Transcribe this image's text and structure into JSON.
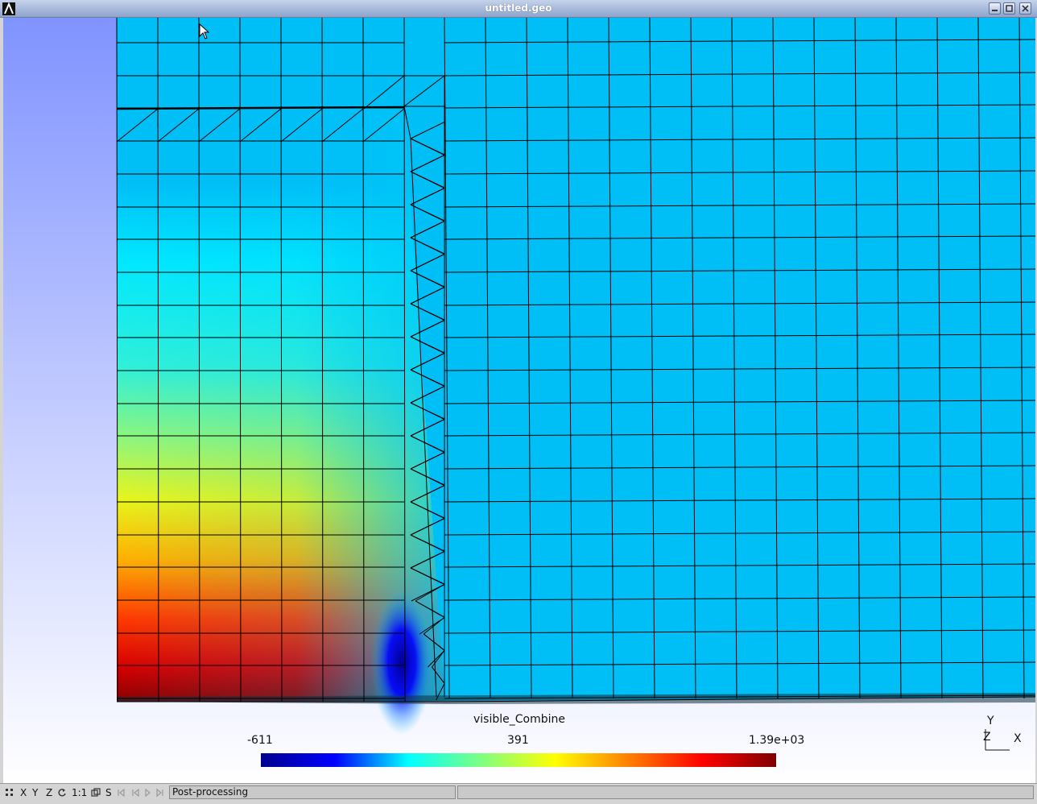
{
  "window": {
    "title": "untitled.geo"
  },
  "view": {
    "label": "visible_Combine",
    "scale": {
      "min": "-611",
      "mid": "391",
      "max": "1.39e+03"
    },
    "colormap": [
      "#00008f",
      "#0000ff",
      "#00ffff",
      "#7fff7f",
      "#ffff00",
      "#ff7f00",
      "#ff0000",
      "#7f0000"
    ],
    "mesh_color": "#000000",
    "outer_field_color": "#00bff7"
  },
  "axes": {
    "y": "Y",
    "z": "Z",
    "x": "X"
  },
  "statusbar": {
    "buttons": [
      "X",
      "Y",
      "Z",
      "1:1",
      "S"
    ],
    "message": "Post-processing"
  }
}
